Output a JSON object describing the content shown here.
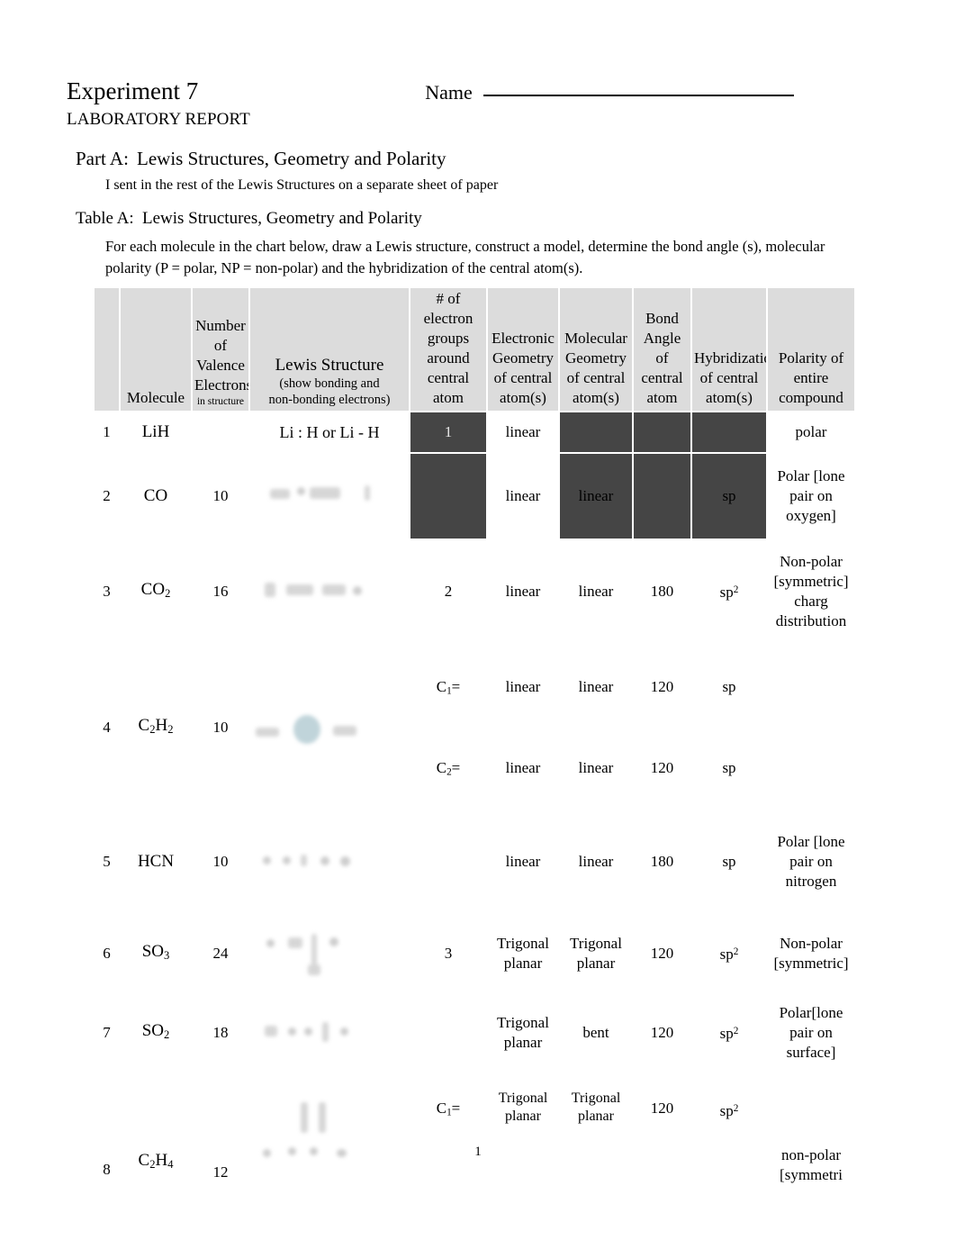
{
  "header": {
    "experiment_title": "Experiment 7",
    "name_label": "Name",
    "lab_report": "LABORATORY REPORT"
  },
  "part_a": {
    "label": "Part A:",
    "title": "Lewis Structures, Geometry and Polarity",
    "note": "I sent in the rest of the Lewis Structures on a separate sheet of paper"
  },
  "table_a": {
    "label": "Table A:",
    "title": "Lewis Structures, Geometry and Polarity",
    "description": "For each molecule in the chart below, draw a Lewis structure, construct a model, determine the bond angle (s), molecular polarity (P = polar, NP = non-polar) and the hybridization of the central atom(s)."
  },
  "columns": {
    "index": "",
    "molecule": "Molecule",
    "valence_l1": "Number of",
    "valence_l2": "Valence",
    "valence_l3": "Electrons",
    "valence_l4": "in structure",
    "lewis_main": "Lewis Structure",
    "lewis_sub1": "(show bonding and",
    "lewis_sub2": "non-bonding electrons)",
    "egroups_l1": "# of electron",
    "egroups_l2": "groups",
    "egroups_l3": "around",
    "egroups_l4": "central atom",
    "egeom_l1": "Electronic",
    "egeom_l2": "Geometry",
    "egeom_l3": "of central",
    "egeom_l4": "atom(s)",
    "mgeom_l1": "Molecular",
    "mgeom_l2": "Geometry",
    "mgeom_l3": "of central",
    "mgeom_l4": "atom(s)",
    "angle_l1": "Bond",
    "angle_l2": "Angle of",
    "angle_l3": "central",
    "angle_l4": "atom",
    "hybrid_l1": "Hybridization",
    "hybrid_l2": "of central",
    "hybrid_l3": "atom(s)",
    "polarity_l1": "Polarity of",
    "polarity_l2": "entire",
    "polarity_l3": "compound"
  },
  "rows": {
    "r1": {
      "index": "1",
      "molecule": "LiH",
      "valence": "",
      "lewis_text": "Li : H or Li - H",
      "egroups": "1",
      "egeom": "linear",
      "mgeom": "",
      "angle": "",
      "hybrid": "",
      "polarity": "polar"
    },
    "r2": {
      "index": "2",
      "molecule": "CO",
      "valence": "10",
      "egroups": "",
      "egeom": "linear",
      "mgeom": "linear",
      "angle": "",
      "hybrid": "sp",
      "polarity": "Polar [lone pair on oxygen]"
    },
    "r3": {
      "index": "3",
      "molecule_base": "CO",
      "molecule_sub": "2",
      "valence": "16",
      "egroups": "2",
      "egeom": "linear",
      "mgeom": "linear",
      "angle": "180",
      "hybrid_base": "sp",
      "hybrid_sup": "2",
      "polarity": "Non-polar [symmetric] charg distribution"
    },
    "r4": {
      "index": "4",
      "molecule_c": "C",
      "molecule_c_sub": "2",
      "molecule_h": "H",
      "molecule_h_sub": "2",
      "valence": "10",
      "sub1": {
        "egroups_base": "C",
        "egroups_sub": "1",
        "egroups_eq": "=",
        "egeom": "linear",
        "mgeom": "linear",
        "angle": "120",
        "hybrid": "sp"
      },
      "sub2": {
        "egroups_base": "C",
        "egroups_sub": "2",
        "egroups_eq": "=",
        "egeom": "linear",
        "mgeom": "linear",
        "angle": "120",
        "hybrid": "sp"
      },
      "polarity": ""
    },
    "r5": {
      "index": "5",
      "molecule": "HCN",
      "valence": "10",
      "egroups": "",
      "egeom": "linear",
      "mgeom": "linear",
      "angle": "180",
      "hybrid": "sp",
      "polarity": "Polar [lone pair on nitrogen"
    },
    "r6": {
      "index": "6",
      "molecule_base": "SO",
      "molecule_sub": "3",
      "valence": "24",
      "egroups": "3",
      "egeom": "Trigonal planar",
      "mgeom": "Trigonal planar",
      "angle": "120",
      "hybrid_base": "sp",
      "hybrid_sup": "2",
      "polarity": "Non-polar [symmetric]"
    },
    "r7": {
      "index": "7",
      "molecule_base": "SO",
      "molecule_sub": "2",
      "valence": "18",
      "egroups": "",
      "egeom": "Trigonal planar",
      "mgeom": "bent",
      "angle": "120",
      "hybrid_base": "sp",
      "hybrid_sup": "2",
      "polarity": "Polar[lone pair on surface]"
    },
    "r8": {
      "index": "8",
      "molecule_c": "C",
      "molecule_c_sub": "2",
      "molecule_h": "H",
      "molecule_h_sub": "4",
      "valence": "12",
      "sub1": {
        "egroups_base": "C",
        "egroups_sub": "1",
        "egroups_eq": "=",
        "egeom": "Trigonal planar",
        "mgeom": "Trigonal planar",
        "angle": "120",
        "hybrid_base": "sp",
        "hybrid_sup": "2"
      },
      "polarity": "non-polar [symmetri"
    }
  },
  "footer": {
    "page_number": "1"
  }
}
